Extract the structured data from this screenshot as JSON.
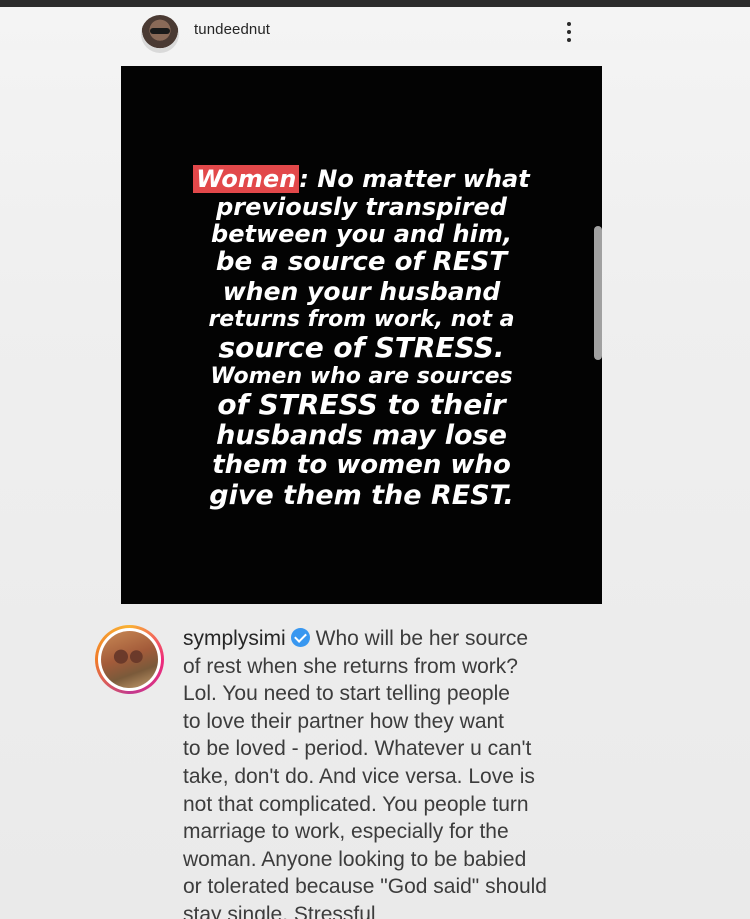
{
  "post": {
    "username": "tundeednut",
    "more_icon": "more-vertical-icon"
  },
  "quote": {
    "highlight": "Women",
    "line1_rest": ": No matter what",
    "line2": "previously transpired",
    "line3": "between you and him,",
    "line4": "be a source of REST",
    "line5": "when your husband",
    "line6": "returns from work, not a",
    "line7": "source of STRESS.",
    "line8": "Women who are sources",
    "line9": "of STRESS to their",
    "line10": "husbands may lose",
    "line11": "them to women who",
    "line12": "give them the REST.",
    "highlight_color": "#e2484a"
  },
  "comment": {
    "username": "symplysimi",
    "verified_icon": "verified-badge-icon",
    "lines": [
      "Who will be her source",
      "of rest when she returns from work?",
      "Lol. You need to start telling people",
      "to love their partner how they want",
      "to be loved - period. Whatever u can't",
      "take, don't do. And vice versa. Love is",
      "not that complicated. You people turn",
      "marriage to work, especially for the",
      "woman. Anyone looking to be babied",
      "or tolerated because \"God said\" should",
      "stay single. Stressful"
    ]
  },
  "colors": {
    "verified": "#3897f0",
    "story_ring": "#ee2a7b"
  }
}
